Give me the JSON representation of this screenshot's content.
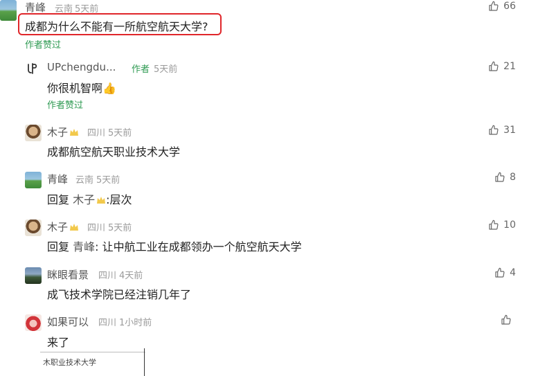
{
  "top_comment": {
    "user": "青峰",
    "location": "云南",
    "time": "5天前",
    "text": "成都为什么不能有一所航空航天大学?",
    "author_liked": "作者赞过",
    "likes": "66"
  },
  "replies": [
    {
      "user": "UPchengdu...",
      "author_tag": "作者",
      "time": "5天前",
      "text": "你很机智啊👍",
      "author_liked": "作者赞过",
      "likes": "21"
    },
    {
      "user": "木子",
      "location": "四川",
      "time": "5天前",
      "text": "成都航空航天职业技术大学",
      "likes": "31"
    },
    {
      "user": "青峰",
      "location": "云南",
      "time": "5天前",
      "reply_word": "回复",
      "reply_target": "木子",
      "text": ":层次",
      "likes": "8"
    },
    {
      "user": "木子",
      "location": "四川",
      "time": "5天前",
      "reply_word": "回复",
      "reply_target": "青峰",
      "text": ": 让中航工业在成都领办一个航空航天大学",
      "likes": "10"
    },
    {
      "user": "眯眼看景",
      "location": "四川",
      "time": "4天前",
      "text": "成飞技术学院已经注销几年了",
      "likes": "4"
    },
    {
      "user": "如果可以",
      "location": "四川",
      "time": "1小时前",
      "text": "来了",
      "likes": ""
    }
  ],
  "image_crop_text": "木职业技术大学",
  "colors": {
    "accent_green": "#2e9a52",
    "highlight_red": "#e0262a"
  }
}
